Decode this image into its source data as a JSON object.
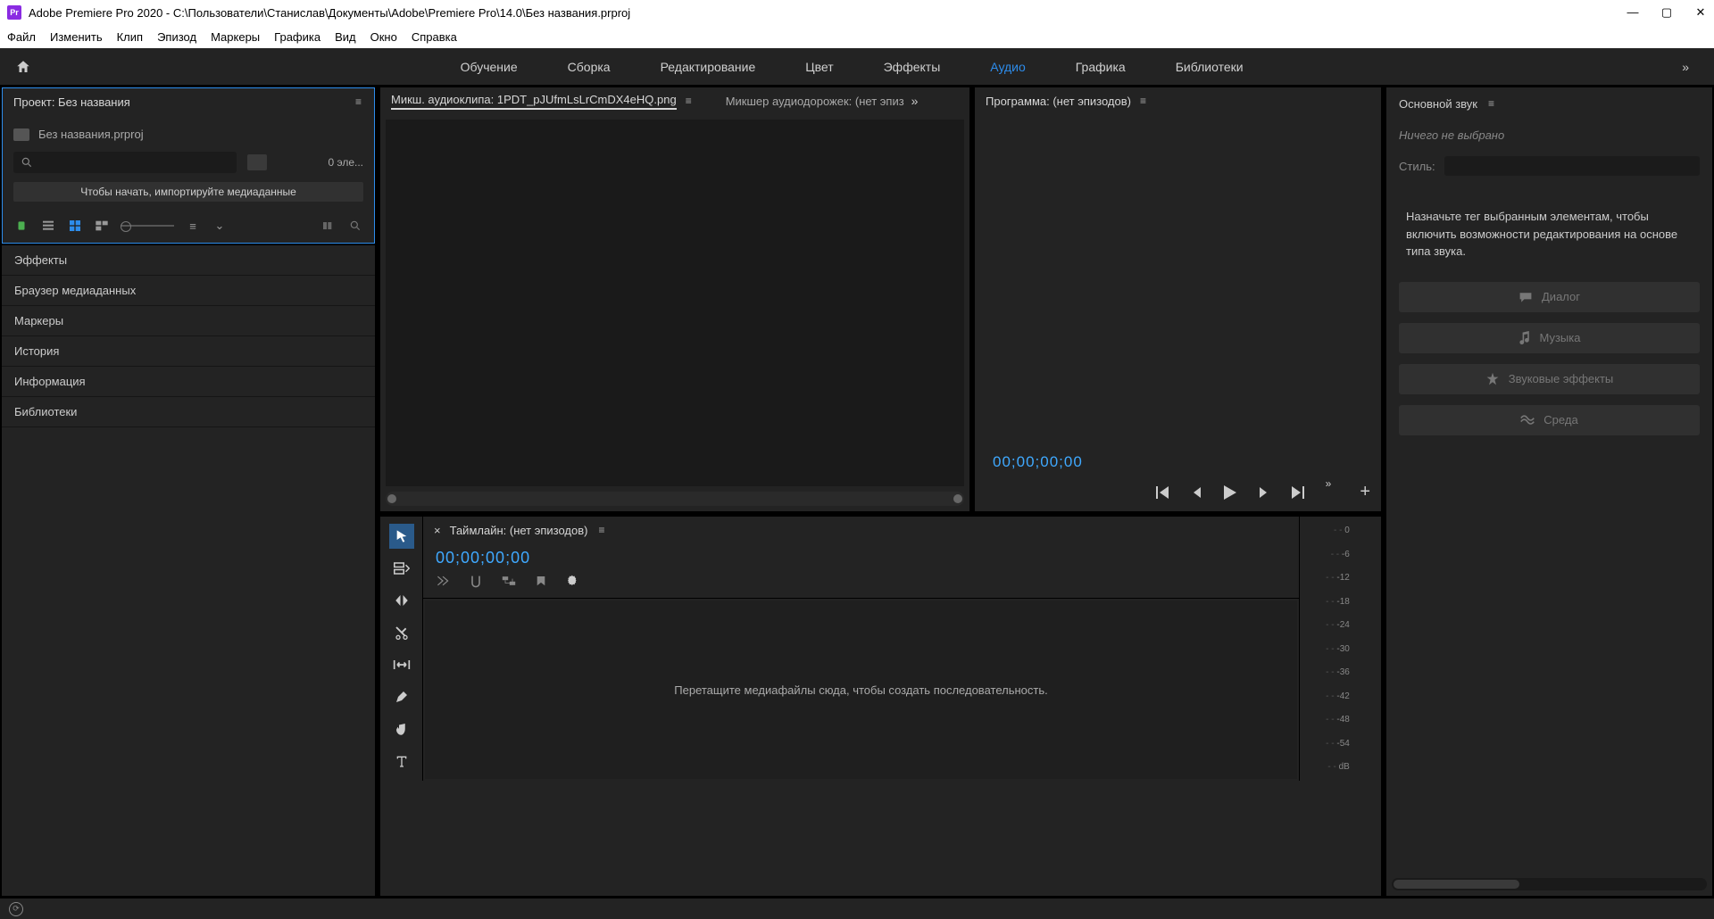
{
  "titlebar": {
    "app": "Adobe Premiere Pro 2020",
    "path": "C:\\Пользователи\\Станислав\\Документы\\Adobe\\Premiere Pro\\14.0\\Без названия.prproj"
  },
  "menu": [
    "Файл",
    "Изменить",
    "Клип",
    "Эпизод",
    "Маркеры",
    "Графика",
    "Вид",
    "Окно",
    "Справка"
  ],
  "workspaces": [
    {
      "label": "Обучение",
      "active": false
    },
    {
      "label": "Сборка",
      "active": false
    },
    {
      "label": "Редактирование",
      "active": false
    },
    {
      "label": "Цвет",
      "active": false
    },
    {
      "label": "Эффекты",
      "active": false
    },
    {
      "label": "Аудио",
      "active": true
    },
    {
      "label": "Графика",
      "active": false
    },
    {
      "label": "Библиотеки",
      "active": false
    }
  ],
  "project": {
    "tab": "Проект: Без названия",
    "filename": "Без названия.prproj",
    "count": "0 эле...",
    "hint": "Чтобы начать, импортируйте медиаданные"
  },
  "stack": [
    "Эффекты",
    "Браузер медиаданных",
    "Маркеры",
    "История",
    "Информация",
    "Библиотеки"
  ],
  "source_tabs": {
    "a": "Микш. аудиоклипа: 1PDT_pJUfmLsLrCmDX4eHQ.png",
    "b": "Микшер аудиодорожек: (нет эпиз"
  },
  "program": {
    "tab": "Программа: (нет эпизодов)",
    "timecode": "00;00;00;00"
  },
  "timeline": {
    "tab": "Таймлайн: (нет эпизодов)",
    "timecode": "00;00;00;00",
    "drop": "Перетащите медиафайлы сюда, чтобы создать последовательность."
  },
  "meter": [
    "0",
    "-6",
    "-12",
    "-18",
    "-24",
    "-30",
    "-36",
    "-42",
    "-48",
    "-54",
    "dB"
  ],
  "essential_sound": {
    "title": "Основной звук",
    "nothing": "Ничего не выбрано",
    "style": "Стиль:",
    "hint": "Назначьте тег выбранным элементам, чтобы включить возможности редактирования на основе типа звука.",
    "buttons": [
      "Диалог",
      "Музыка",
      "Звуковые эффекты",
      "Среда"
    ]
  }
}
